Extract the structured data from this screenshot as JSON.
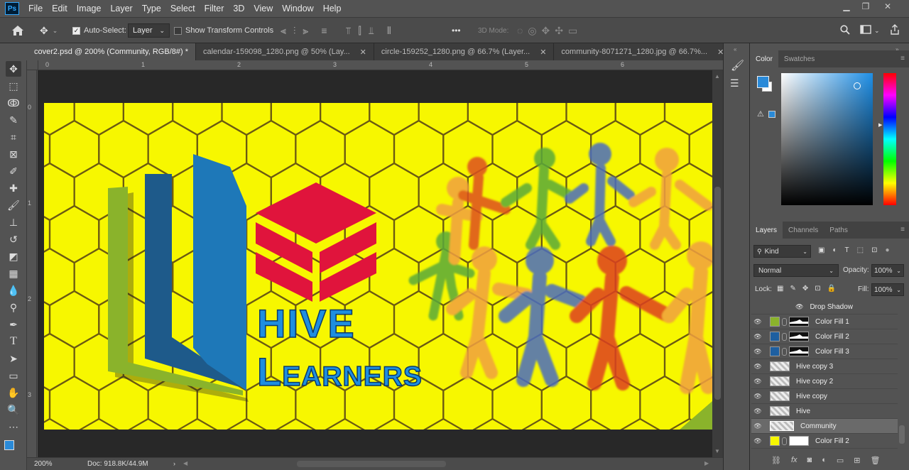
{
  "app": {
    "logo": "Ps",
    "menus": [
      "File",
      "Edit",
      "Image",
      "Layer",
      "Type",
      "Select",
      "Filter",
      "3D",
      "View",
      "Window",
      "Help"
    ],
    "window_controls": [
      "minimize-icon",
      "restore-icon",
      "close-icon"
    ]
  },
  "options_bar": {
    "auto_select_label": "Auto-Select:",
    "auto_select_checked": true,
    "target_value": "Layer",
    "transform_controls_label": "Show Transform Controls",
    "transform_controls_checked": false,
    "mode_3d_label": "3D Mode:",
    "more_label": "•••"
  },
  "tabs": [
    {
      "label": "cover2.psd @ 200% (Community, RGB/8#) *",
      "active": true
    },
    {
      "label": "calendar-159098_1280.png @ 50% (Lay...",
      "active": false
    },
    {
      "label": "circle-159252_1280.png @ 66.7% (Layer...",
      "active": false
    },
    {
      "label": "community-8071271_1280.jpg @ 66.7%...",
      "active": false
    }
  ],
  "rulers": {
    "top": [
      "0",
      "1",
      "2",
      "3",
      "4",
      "5",
      "6"
    ],
    "left": [
      "0",
      "1",
      "2",
      "3"
    ]
  },
  "canvas": {
    "title_line1": "Hive",
    "title_line2": "Learners",
    "background_color": "#f7f700",
    "hex_line_color": "#6b5a12"
  },
  "status": {
    "zoom": "200%",
    "doc": "Doc: 918.8K/44.9M"
  },
  "color_panel": {
    "tabs": [
      "Color",
      "Swatches"
    ],
    "foreground": "#2a8ad8",
    "background": "#ffffff"
  },
  "layers_panel": {
    "tabs": [
      "Layers",
      "Channels",
      "Paths"
    ],
    "filter_kind": "Kind",
    "blend_mode": "Normal",
    "opacity_label": "Opacity:",
    "opacity_value": "100%",
    "lock_label": "Lock:",
    "fill_label": "Fill:",
    "fill_value": "100%",
    "layers": [
      {
        "name": "Drop Shadow",
        "type": "effect",
        "eye": true
      },
      {
        "name": "Color Fill 1",
        "type": "fill",
        "color": "#8ab32b",
        "eye": true
      },
      {
        "name": "Color Fill 2",
        "type": "fill",
        "color": "#1e5fa0",
        "eye": true
      },
      {
        "name": "Color Fill 3",
        "type": "fill",
        "color": "#1e5fa0",
        "eye": true
      },
      {
        "name": "Hive copy 3",
        "type": "layer",
        "eye": true
      },
      {
        "name": "Hive copy 2",
        "type": "layer",
        "eye": true
      },
      {
        "name": "Hive copy",
        "type": "layer",
        "eye": true
      },
      {
        "name": "Hive",
        "type": "layer",
        "eye": true
      },
      {
        "name": "Community",
        "type": "layer",
        "eye": true,
        "selected": true
      },
      {
        "name": "Color Fill 2",
        "type": "fill",
        "color": "#f7f700",
        "eye": true
      }
    ]
  }
}
